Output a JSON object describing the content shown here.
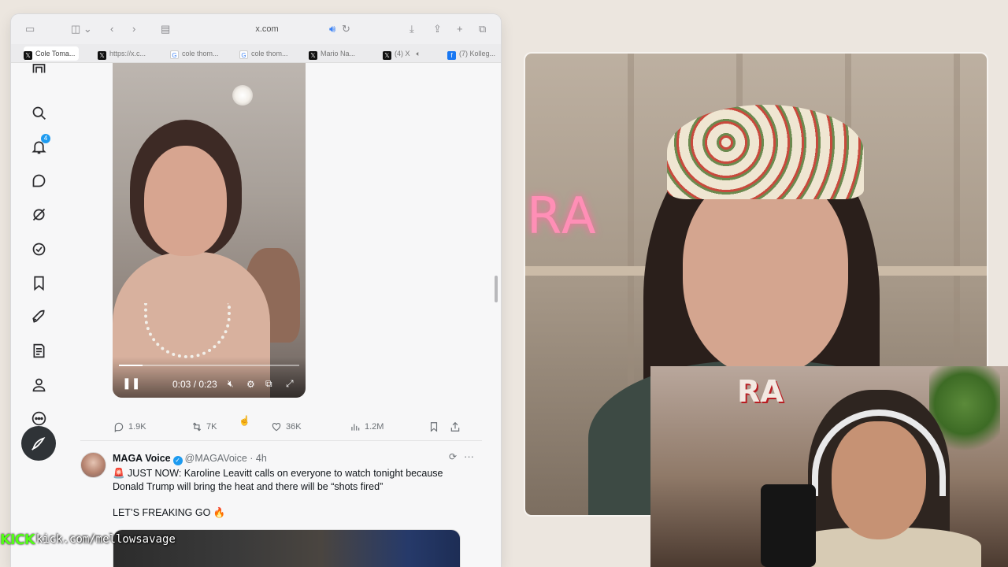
{
  "browser": {
    "url": "x.com",
    "tabs": [
      {
        "label": "Cole Toma...",
        "favicon": "x-logo-icon",
        "active": true
      },
      {
        "label": "https://x.c...",
        "favicon": "x-logo-icon",
        "active": false
      },
      {
        "label": "cole thom...",
        "favicon": "google-icon",
        "active": false
      },
      {
        "label": "cole thom...",
        "favicon": "google-icon",
        "active": false
      },
      {
        "label": "Mario Na...",
        "favicon": "x-logo-icon",
        "active": false
      },
      {
        "label": "(4) X",
        "favicon": "x-logo-icon",
        "active": false
      },
      {
        "label": "(7) Kolleg...",
        "favicon": "facebook-icon",
        "active": false
      }
    ]
  },
  "sidenav": {
    "items": [
      {
        "name": "grok-icon"
      },
      {
        "name": "search-icon"
      },
      {
        "name": "notifications-icon",
        "badge": "4"
      },
      {
        "name": "messages-icon"
      },
      {
        "name": "grok-circle-icon"
      },
      {
        "name": "verified-orgs-icon"
      },
      {
        "name": "bookmarks-icon"
      },
      {
        "name": "rocket-icon"
      },
      {
        "name": "premium-icon"
      },
      {
        "name": "profile-icon"
      },
      {
        "name": "more-icon"
      }
    ],
    "post_button_icon": "compose-icon"
  },
  "video": {
    "time": "0:03 / 0:23",
    "progress": 0.13
  },
  "tweet_actions": {
    "replies": "1.9K",
    "reposts": "7K",
    "likes": "36K",
    "views": "1.2M"
  },
  "tweet": {
    "name": "MAGA Voice",
    "handle": "@MAGAVoice",
    "time": "· 4h",
    "text": "🚨 JUST NOW: Karoline Leavitt calls on everyone to watch tonight because Donald Trump will bring the heat and there will be “shots fired”",
    "text2": "LET’S FREAKING GO 🔥"
  },
  "overlay": {
    "kick_logo": "KICK",
    "kick_url": "kick.com/mellowsavage"
  },
  "webcam": {
    "neon_sign": "RA",
    "pip_sign": "RA"
  },
  "colors": {
    "accent": "#1d9bf0",
    "kick_green": "#53fc18",
    "page_bg": "#ece6df"
  }
}
